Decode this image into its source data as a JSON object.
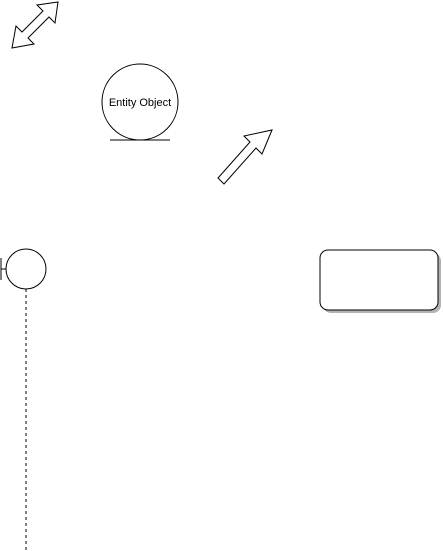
{
  "diagram": {
    "entity_object": {
      "label": "Entity Object"
    },
    "shapes": [
      {
        "name": "double-arrow",
        "kind": "bidirectional block arrow"
      },
      {
        "name": "entity-object",
        "kind": "entity circle with underline"
      },
      {
        "name": "single-arrow",
        "kind": "block arrow pointing up-right"
      },
      {
        "name": "boundary-lifeline",
        "kind": "boundary object with dashed lifeline"
      },
      {
        "name": "rounded-rectangle",
        "kind": "rounded rectangle with shadow"
      }
    ],
    "colors": {
      "stroke": "#000000",
      "fill": "#ffffff",
      "shadow": "#b3b3b3"
    }
  }
}
